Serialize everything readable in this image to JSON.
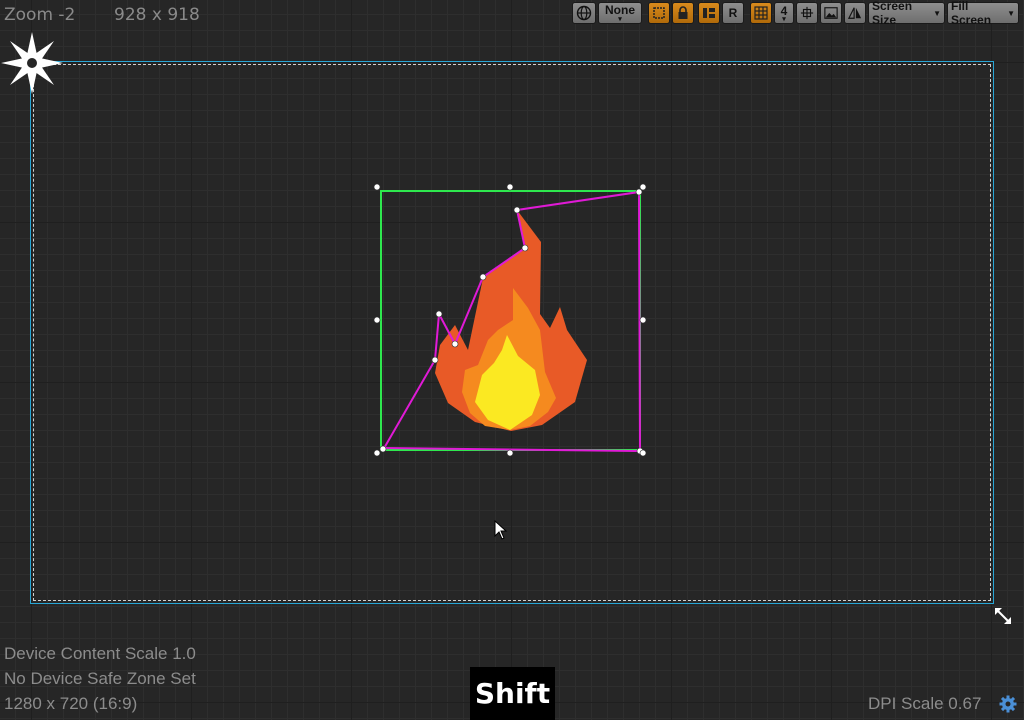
{
  "header": {
    "zoom": "Zoom -2",
    "resolution": "928 x 918"
  },
  "toolbar": {
    "world_icon": "globe-icon",
    "preview_mode": "None",
    "transform_icon": "transform-icon",
    "lock_icon": "lock-icon",
    "layout_icon": "layout-icon",
    "respect_locks_label": "R",
    "grid_icon": "grid-icon",
    "grid_snap_value": "4",
    "pan_icon": "move-icon",
    "background_icon": "image-icon",
    "flip_icon": "mirror-icon",
    "screen_size_label": "Screen Size",
    "fill_screen_label": "Fill Screen"
  },
  "status": {
    "content_scale": "Device Content Scale 1.0",
    "safe_zone": "No Device Safe Zone Set",
    "screen_res": "1280 x 720 (16:9)",
    "dpi_scale": "DPI Scale 0.67"
  },
  "key_overlay": {
    "key": "Shift"
  },
  "colors": {
    "canvas_border": "#29a6d6",
    "selection_box": "#2ee84e",
    "geometry_line": "#e01ad6",
    "flame_outer": "#e85a27",
    "flame_mid": "#f58a1f",
    "flame_core": "#fbe922",
    "toolbar_active": "#d88a1c"
  }
}
